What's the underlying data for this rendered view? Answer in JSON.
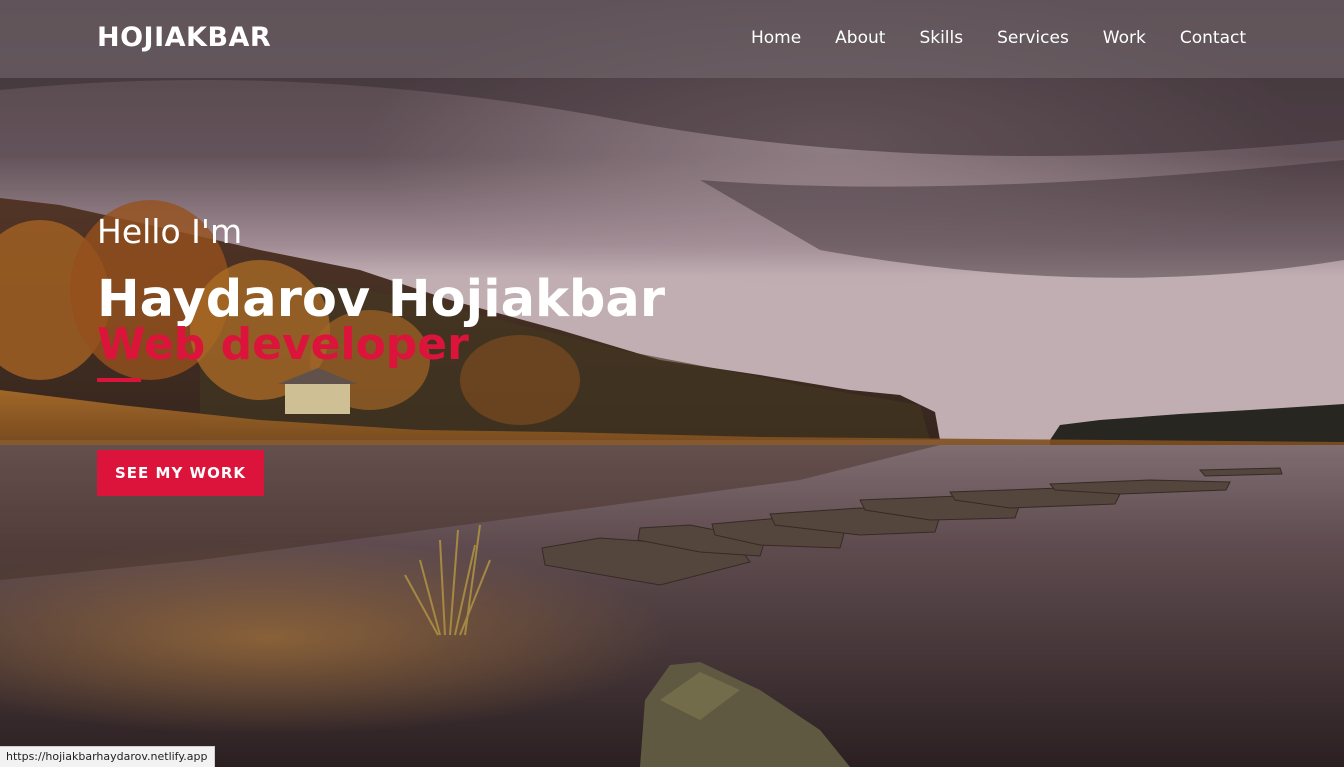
{
  "nav": {
    "brand": "HOJIAKBAR",
    "links": [
      {
        "label": "Home"
      },
      {
        "label": "About"
      },
      {
        "label": "Skills"
      },
      {
        "label": "Services"
      },
      {
        "label": "Work"
      },
      {
        "label": "Contact"
      }
    ]
  },
  "hero": {
    "greeting": "Hello I'm",
    "name": "Haydarov Hojiakbar",
    "role": "Web developer",
    "cta_label": "SEE MY WORK"
  },
  "status_bar": {
    "url": "https://hojiakbarhaydarov.netlify.app"
  },
  "colors": {
    "accent": "#dc143c",
    "text_light": "#ffffff",
    "nav_overlay": "rgba(120,110,115,0.55)"
  }
}
